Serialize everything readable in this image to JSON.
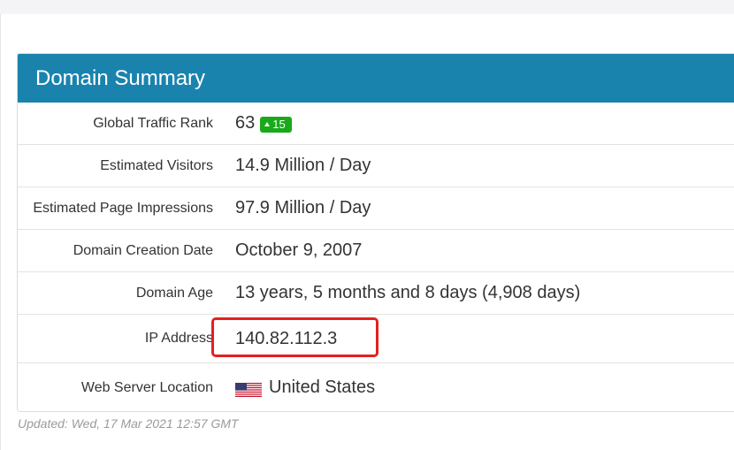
{
  "card": {
    "title": "Domain Summary",
    "rows": [
      {
        "label": "Global Traffic Rank",
        "value": "63",
        "badge": "15"
      },
      {
        "label": "Estimated Visitors",
        "value": "14.9 Million / Day"
      },
      {
        "label": "Estimated Page Impressions",
        "value": "97.9 Million / Day"
      },
      {
        "label": "Domain Creation Date",
        "value": "October 9, 2007"
      },
      {
        "label": "Domain Age",
        "value": "13 years, 5 months and 8 days (4,908 days)"
      },
      {
        "label": "IP Address",
        "value": "140.82.112.3"
      },
      {
        "label": "Web Server Location",
        "value": "United States",
        "icon": "us-flag-icon"
      }
    ]
  },
  "updated": "Updated: Wed, 17 Mar 2021 12:57 GMT",
  "colors": {
    "header": "#1a83ad",
    "badge": "#1aa91a",
    "highlight": "#e3211f"
  }
}
